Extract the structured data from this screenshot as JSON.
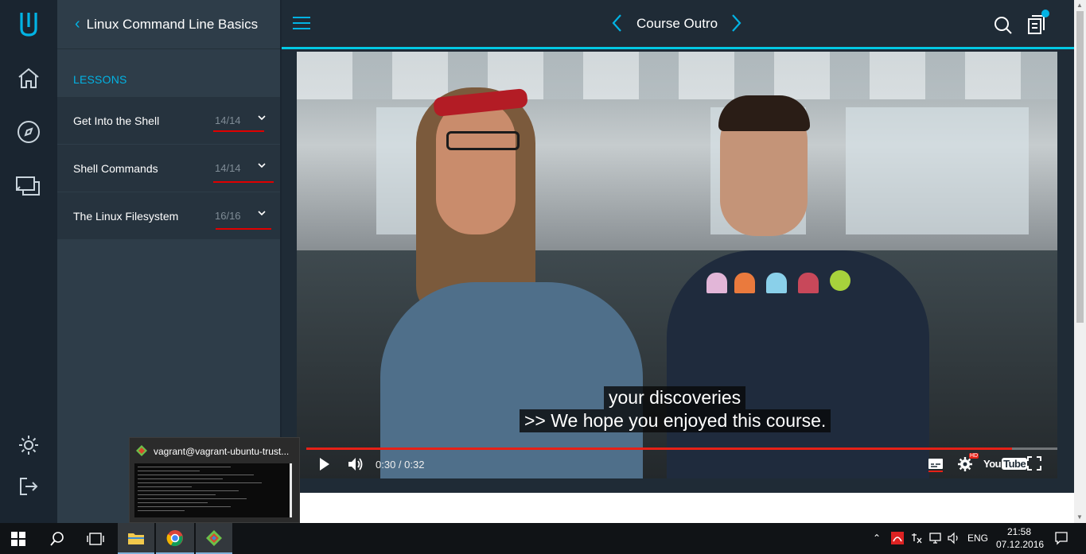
{
  "course": {
    "back_label": "‹",
    "title": "Linux Command Line Basics"
  },
  "lessons_label": "LESSONS",
  "lessons": [
    {
      "name": "Get Into the Shell",
      "progress": "14/14"
    },
    {
      "name": "Shell Commands",
      "progress": "14/14"
    },
    {
      "name": "The Linux Filesystem",
      "progress": "16/16"
    }
  ],
  "header": {
    "concept_title": "Course Outro"
  },
  "video": {
    "captions": [
      "your discoveries",
      ">> We hope you enjoyed this course."
    ],
    "time": "0:30 / 0:32",
    "progress_fraction": 0.94,
    "youtube_label": "You",
    "youtube_tube": "Tube",
    "hd_badge": "HD"
  },
  "taskbar_preview": {
    "title": "vagrant@vagrant-ubuntu-trust..."
  },
  "tray": {
    "language": "ENG",
    "time": "21:58",
    "date": "07.12.2016"
  },
  "colors": {
    "accent": "#02b3e4",
    "youtube_red": "#e62117",
    "annotation_red": "#e00000"
  },
  "icons": {
    "rail": [
      "udacity-logo-icon",
      "home-icon",
      "compass-icon",
      "chat-icon",
      "settings-icon",
      "logout-icon"
    ],
    "header": [
      "hamburger-icon",
      "chevron-left-icon",
      "chevron-right-icon",
      "search-icon",
      "notes-icon"
    ],
    "player": [
      "play-icon",
      "volume-icon",
      "subtitles-icon",
      "settings-gear-icon",
      "youtube-logo-icon",
      "fullscreen-icon"
    ],
    "taskbar": [
      "windows-start-icon",
      "search-icon",
      "task-view-icon",
      "file-explorer-icon",
      "chrome-icon",
      "git-icon"
    ]
  }
}
